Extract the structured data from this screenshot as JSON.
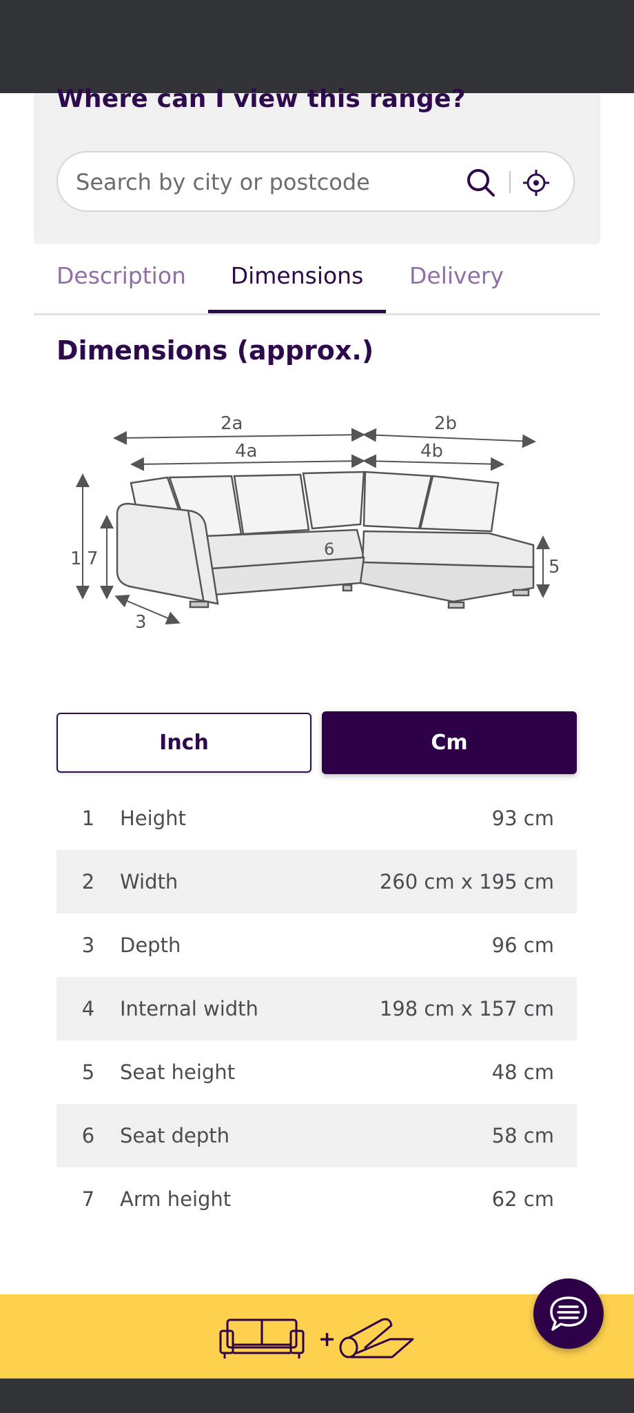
{
  "store_locator": {
    "title": "Where can I view this range?",
    "search_placeholder": "Search by city or postcode"
  },
  "tabs": [
    {
      "label": "Description",
      "active": false
    },
    {
      "label": "Dimensions",
      "active": true
    },
    {
      "label": "Delivery",
      "active": false
    }
  ],
  "section_title": "Dimensions (approx.)",
  "diagram_labels": {
    "l1": "1",
    "l2a": "2a",
    "l2b": "2b",
    "l3": "3",
    "l4a": "4a",
    "l4b": "4b",
    "l5": "5",
    "l6": "6",
    "l7": "7"
  },
  "units": {
    "inch": "Inch",
    "cm": "Cm",
    "selected": "Cm"
  },
  "dimensions": [
    {
      "num": "1",
      "label": "Height",
      "value": "93 cm"
    },
    {
      "num": "2",
      "label": "Width",
      "value": "260 cm x 195 cm"
    },
    {
      "num": "3",
      "label": "Depth",
      "value": "96 cm"
    },
    {
      "num": "4",
      "label": "Internal width",
      "value": "198 cm x 157 cm"
    },
    {
      "num": "5",
      "label": "Seat height",
      "value": "48 cm"
    },
    {
      "num": "6",
      "label": "Seat depth",
      "value": "58 cm"
    },
    {
      "num": "7",
      "label": "Arm height",
      "value": "62 cm"
    }
  ],
  "promo": {
    "plus": "+",
    "icons": [
      "sofa-icon",
      "rug-icon"
    ]
  },
  "colors": {
    "brand_purple": "#2d0048",
    "promo_yellow": "#fdd04e"
  }
}
